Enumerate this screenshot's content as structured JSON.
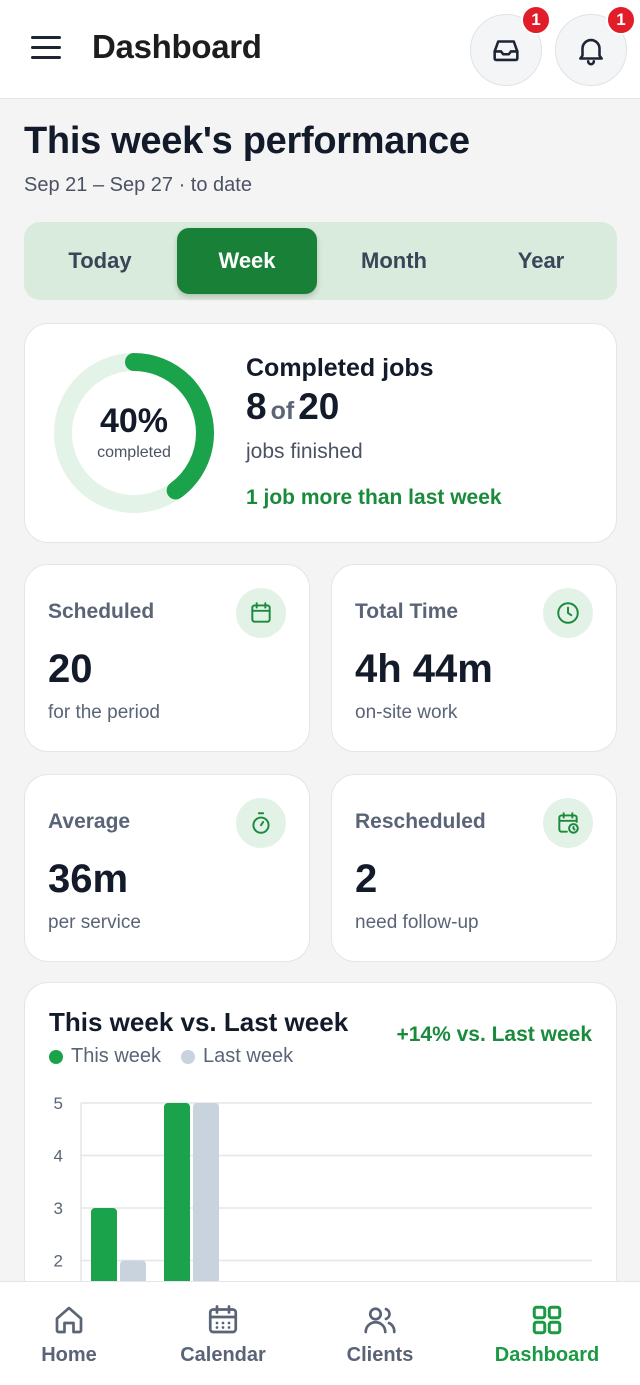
{
  "header": {
    "title": "Dashboard",
    "inbox_badge": "1",
    "notifications_badge": "1"
  },
  "performance": {
    "title": "This week's performance",
    "subtitle": "Sep 21 – Sep 27 · to date"
  },
  "tabs": [
    {
      "label": "Today"
    },
    {
      "label": "Week"
    },
    {
      "label": "Month"
    },
    {
      "label": "Year"
    }
  ],
  "active_tab": "Week",
  "completed": {
    "percent_label": "40%",
    "percent_value": 0.4,
    "caption": "completed",
    "title": "Completed jobs",
    "done": "8",
    "of": "of",
    "total": "20",
    "description": "jobs finished",
    "trend": "1 job more than last week"
  },
  "stats": [
    {
      "label": "Scheduled",
      "value": "20",
      "note": "for the period",
      "icon": "calendar-icon"
    },
    {
      "label": "Total Time",
      "value": "4h 44m",
      "note": "on-site work",
      "icon": "clock-icon"
    },
    {
      "label": "Average",
      "value": "36m",
      "note": "per service",
      "icon": "stopwatch-icon"
    },
    {
      "label": "Rescheduled",
      "value": "2",
      "note": "need follow-up",
      "icon": "calendar-clock-icon"
    }
  ],
  "chart": {
    "title": "This week vs. Last week",
    "trend": "+14% vs. Last week"
  },
  "chart_data": {
    "type": "bar",
    "title": "This week vs. Last week",
    "y_ticks": [
      "5",
      "4",
      "3",
      "2"
    ],
    "ylim": [
      1,
      5
    ],
    "grid": true,
    "legend_position": "top-left",
    "series": [
      {
        "name": "This week",
        "color": "#1aa34a",
        "values": [
          3,
          5
        ]
      },
      {
        "name": "Last week",
        "color": "#c9d3de",
        "values": [
          2,
          5
        ]
      }
    ]
  },
  "nav": [
    {
      "label": "Home",
      "icon": "home-icon"
    },
    {
      "label": "Calendar",
      "icon": "calendar-icon"
    },
    {
      "label": "Clients",
      "icon": "users-icon"
    },
    {
      "label": "Dashboard",
      "icon": "dashboard-icon"
    }
  ],
  "colors": {
    "accent": "#198038",
    "accent_light": "#d9ebdc",
    "badge": "#e11d2a"
  }
}
